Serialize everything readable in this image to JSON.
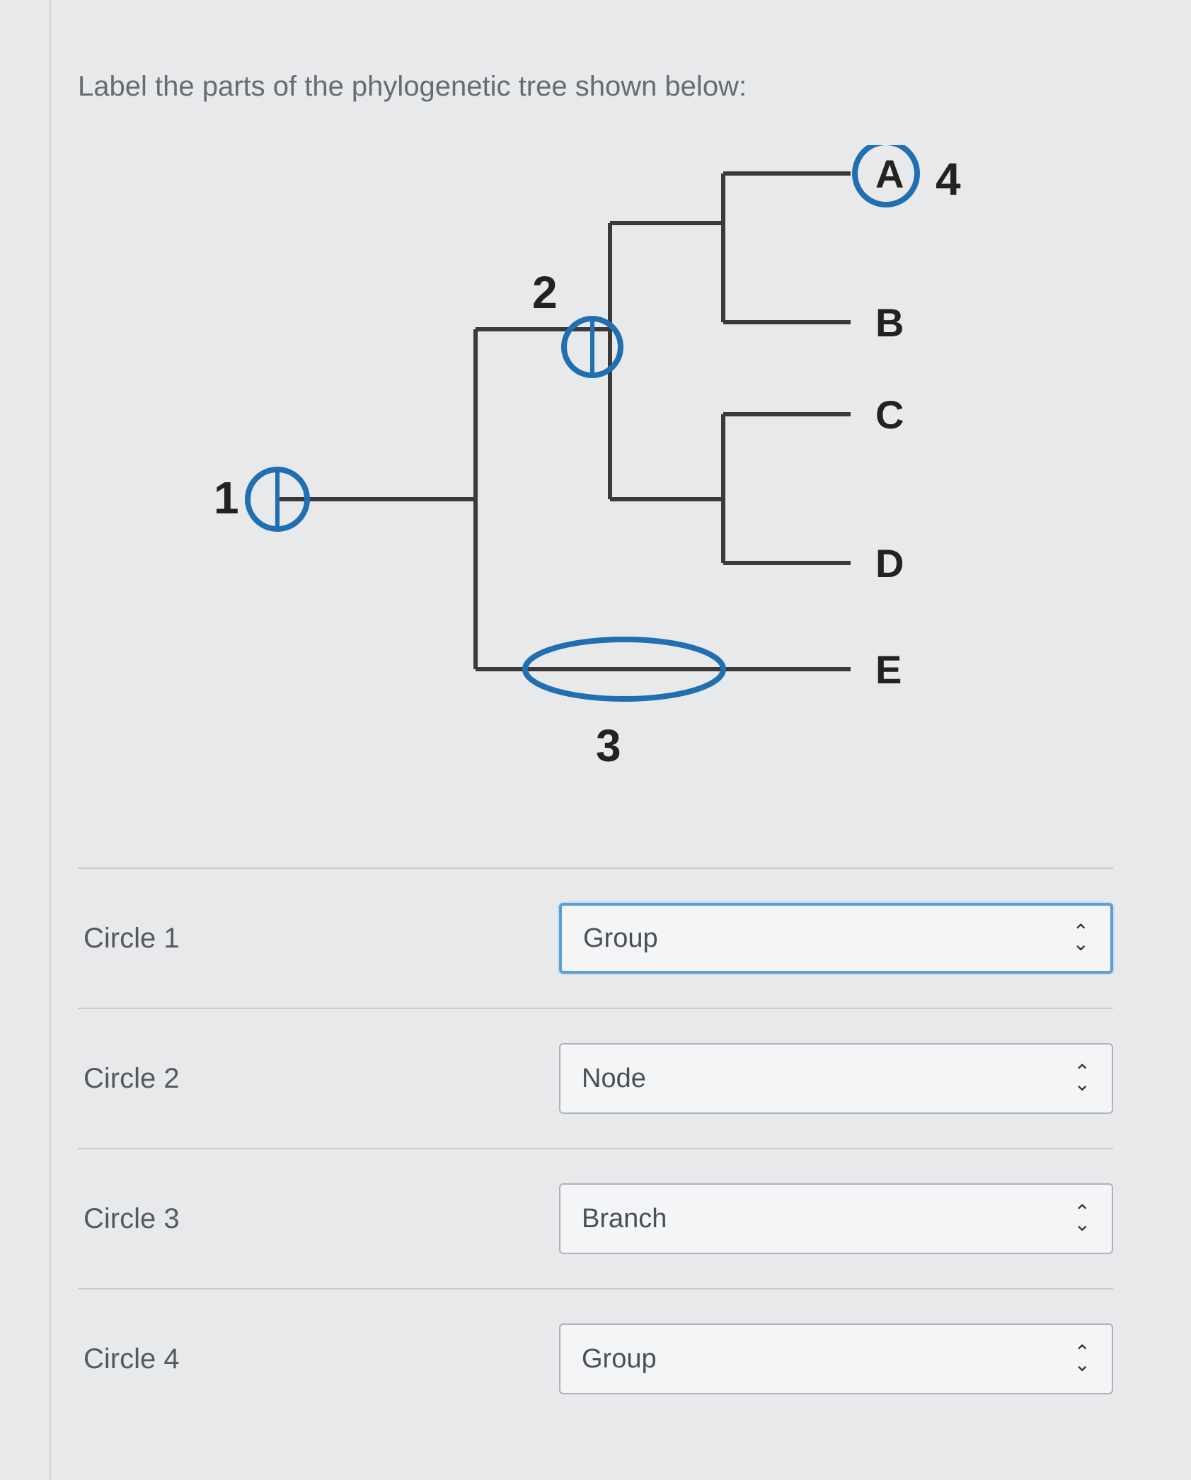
{
  "prompt": "Label the parts of the phylogenetic tree shown below:",
  "tree": {
    "labels": {
      "n1": "1",
      "n2": "2",
      "n3": "3",
      "n4": "4"
    },
    "tips": {
      "a": "A",
      "b": "B",
      "c": "C",
      "d": "D",
      "e": "E"
    }
  },
  "rows": [
    {
      "label": "Circle 1",
      "value": "Group",
      "focused": true
    },
    {
      "label": "Circle 2",
      "value": "Node",
      "focused": false
    },
    {
      "label": "Circle 3",
      "value": "Branch",
      "focused": false
    },
    {
      "label": "Circle 4",
      "value": "Group",
      "focused": false
    }
  ]
}
